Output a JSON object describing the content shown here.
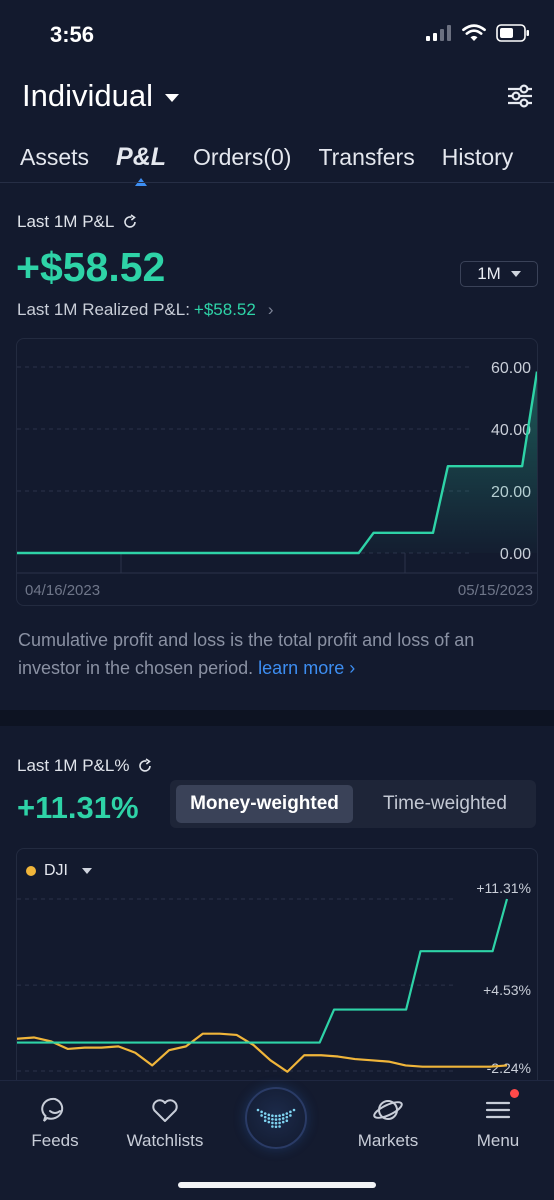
{
  "status": {
    "time": "3:56"
  },
  "account": {
    "name": "Individual"
  },
  "tabs": [
    {
      "label": "Assets"
    },
    {
      "label": "P&L",
      "active": true
    },
    {
      "label": "Orders(0)"
    },
    {
      "label": "Transfers"
    },
    {
      "label": "History"
    }
  ],
  "pnl": {
    "label": "Last 1M P&L",
    "value": "+$58.52",
    "period": "1M",
    "realized_label": "Last 1M Realized P&L:",
    "realized_value": "+$58.52",
    "start_date": "04/16/2023",
    "end_date": "05/15/2023",
    "note": "Cumulative profit and loss is the total profit and loss of an investor in the chosen period.",
    "learn_more": "learn more"
  },
  "pnl_pct": {
    "label": "Last 1M P&L%",
    "value": "+11.31%",
    "seg_active": "Money-weighted",
    "seg_inactive": "Time-weighted",
    "benchmark": "DJI"
  },
  "nav": [
    {
      "label": "Feeds"
    },
    {
      "label": "Watchlists"
    },
    {
      "label": "Markets"
    },
    {
      "label": "Menu"
    }
  ],
  "colors": {
    "accent_green": "#2ed3a7",
    "accent_blue": "#3d8ef2",
    "benchmark_yellow": "#f0b53a",
    "background": "#131a2e"
  },
  "chart_data": [
    {
      "type": "line",
      "ylim": [
        0,
        60
      ],
      "y_ticks": [
        "60.00",
        "40.00",
        "20.00",
        "0.00"
      ],
      "x_tick_labels": [
        "04/16/2023",
        "05/15/2023"
      ],
      "series": [
        {
          "values": [
            0,
            0,
            0,
            0,
            0,
            0,
            0,
            0,
            0,
            0,
            0,
            0,
            0,
            0,
            0,
            0,
            0,
            0,
            0,
            0,
            0,
            0,
            0,
            0,
            6.5,
            6.5,
            6.5,
            6.5,
            6.5,
            28,
            28,
            28,
            28,
            28,
            28,
            58.52
          ]
        }
      ]
    },
    {
      "type": "line",
      "ylim": [
        -2.24,
        11.31
      ],
      "y_ticks": [
        "+11.31%",
        "+4.53%",
        "-2.24%"
      ],
      "series": [
        {
          "values": [
            0,
            0,
            0,
            0,
            0,
            0,
            0,
            0,
            0,
            0,
            0,
            0,
            0,
            0,
            0,
            0,
            0,
            0,
            0,
            0,
            0,
            0,
            2.6,
            2.6,
            2.6,
            2.6,
            2.6,
            2.6,
            7.2,
            7.2,
            7.2,
            7.2,
            7.2,
            7.2,
            11.31
          ]
        },
        {
          "name": "DJI",
          "values": [
            0.3,
            0.4,
            0.1,
            -0.5,
            -0.4,
            -0.4,
            -0.3,
            -0.8,
            -1.8,
            -0.6,
            -0.3,
            0.7,
            0.7,
            0.6,
            -0.2,
            -1.4,
            -2.3,
            -1.0,
            -1.0,
            -1.1,
            -1.3,
            -1.4,
            -1.5,
            -1.8,
            -1.9,
            -1.9,
            -1.9,
            -1.9,
            -1.9,
            -1.8
          ]
        }
      ]
    }
  ]
}
